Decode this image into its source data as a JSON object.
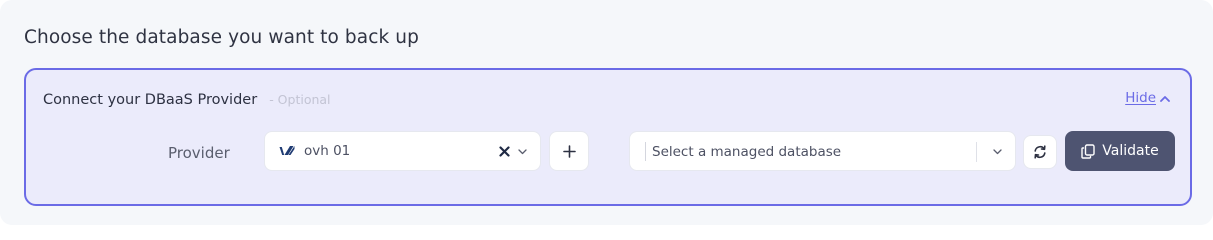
{
  "page": {
    "title": "Choose the database you want to back up"
  },
  "provider_panel": {
    "title": "Connect your DBaaS Provider",
    "optional_label": "- Optional",
    "toggle_label": "Hide",
    "toggle_icon": "chevron-up-icon",
    "accent_color": "#6b6be6",
    "provider_field": {
      "label": "Provider",
      "value": "ovh 01",
      "logo": "ovh-logo-icon"
    },
    "add_button_label": "+",
    "database_field": {
      "placeholder": "Select a managed database"
    },
    "refresh_icon": "refresh-icon",
    "validate_button": {
      "label": "Validate",
      "icon": "copy-icon",
      "color": "#4e5471"
    }
  }
}
